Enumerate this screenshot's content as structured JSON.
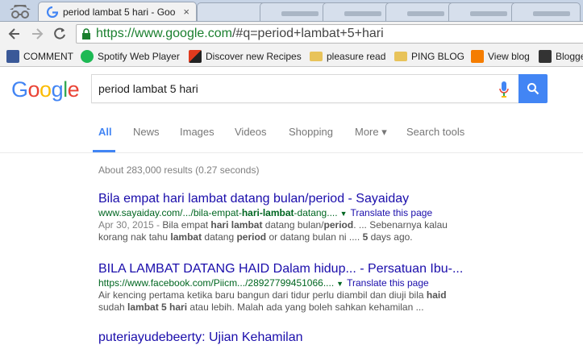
{
  "browser": {
    "active_tab_title": "period lambat 5 hari - Goo",
    "tab_close": "×",
    "url_host": "https://www.google.com",
    "url_rest": "/#q=period+lambat+5+hari"
  },
  "bookmarks": [
    {
      "label": "COMMENT",
      "icon": "facebook-icon",
      "color": "#3b5998"
    },
    {
      "label": "Spotify Web Player",
      "icon": "spotify-icon",
      "color": "#1db954"
    },
    {
      "label": "Discover new Recipes",
      "icon": "recipes-icon",
      "color": "#e03a1e"
    },
    {
      "label": "pleasure read",
      "icon": "folder-icon",
      "color": "#e8c35a"
    },
    {
      "label": "PING BLOG",
      "icon": "folder-icon",
      "color": "#e8c35a"
    },
    {
      "label": "View blog",
      "icon": "blogger-icon",
      "color": "#f57d00"
    },
    {
      "label": "Blogge",
      "icon": "blogger-b-icon",
      "color": "#333333"
    }
  ],
  "google": {
    "logo": "Google",
    "query": "period lambat 5 hari",
    "tabs": [
      "All",
      "News",
      "Images",
      "Videos",
      "Shopping",
      "More ▾",
      "Search tools"
    ],
    "stats": "About 283,000 results (0.27 seconds)"
  },
  "results": [
    {
      "title": "Bila empat hari lambat datang bulan/period - Sayaiday",
      "url_pre": "www.sayaiday.com/.../bila-empat-",
      "url_b1": "hari-lambat",
      "url_post": "-datang....",
      "translate": "Translate this page",
      "date": "Apr 30, 2015 - ",
      "snip1_a": "Bila empat ",
      "snip1_b1": "hari lambat",
      "snip1_c": " datang bulan/",
      "snip1_b2": "period",
      "snip1_d": ". ... Sebenarnya kalau",
      "snip2_a": "korang nak tahu ",
      "snip2_b1": "lambat",
      "snip2_c": " datang ",
      "snip2_b2": "period",
      "snip2_d": " or datang bulan ni .... ",
      "snip2_b3": "5",
      "snip2_e": " days ago."
    },
    {
      "title": "BILA LAMBAT DATANG HAID Dalam hidup... - Persatuan Ibu-...",
      "url_pre": "https://www.facebook.com/Piicm.../28927799451066....",
      "translate": "Translate this page",
      "snip1_a": "Air kencing pertama ketika baru bangun dari tidur perlu diambil dan diuji bila ",
      "snip1_b1": "haid",
      "snip2_a": "sudah ",
      "snip2_b1": "lambat 5 hari",
      "snip2_c": " atau lebih. Malah ada yang boleh sahkan kehamilan ..."
    },
    {
      "title": "puteriayudebeerty: Ujian Kehamilan"
    }
  ]
}
